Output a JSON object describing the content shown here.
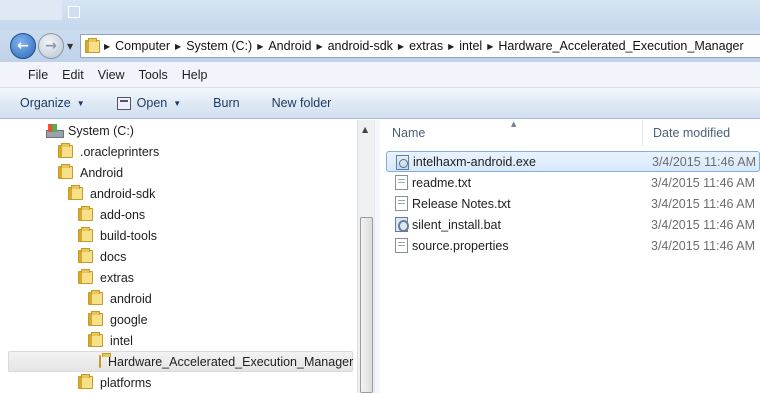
{
  "address": {
    "crumbs": [
      "Computer",
      "System (C:)",
      "Android",
      "android-sdk",
      "extras",
      "intel",
      "Hardware_Accelerated_Execution_Manager"
    ]
  },
  "menu": [
    "File",
    "Edit",
    "View",
    "Tools",
    "Help"
  ],
  "toolbar": {
    "organize": "Organize",
    "open": "Open",
    "burn": "Burn",
    "new_folder": "New folder"
  },
  "tree": [
    {
      "label": "System (C:)",
      "icon": "drive-icon",
      "selected": false
    },
    {
      "label": ".oracleprinters",
      "icon": "folder-icon",
      "selected": false
    },
    {
      "label": "Android",
      "icon": "folder-icon",
      "selected": false
    },
    {
      "label": "android-sdk",
      "icon": "folder-icon",
      "selected": false
    },
    {
      "label": "add-ons",
      "icon": "folder-icon",
      "selected": false
    },
    {
      "label": "build-tools",
      "icon": "folder-icon",
      "selected": false
    },
    {
      "label": "docs",
      "icon": "folder-icon",
      "selected": false
    },
    {
      "label": "extras",
      "icon": "folder-icon",
      "selected": false
    },
    {
      "label": "android",
      "icon": "folder-icon",
      "selected": false
    },
    {
      "label": "google",
      "icon": "folder-icon",
      "selected": false
    },
    {
      "label": "intel",
      "icon": "folder-icon",
      "selected": false
    },
    {
      "label": "Hardware_Accelerated_Execution_Manager",
      "icon": "folder-icon",
      "selected": true
    },
    {
      "label": "platforms",
      "icon": "folder-icon",
      "selected": false
    }
  ],
  "columns": {
    "name": "Name",
    "date": "Date modified"
  },
  "files": [
    {
      "name": "intelhaxm-android.exe",
      "date": "3/4/2015 11:46 AM",
      "icon": "exe-icon",
      "selected": true
    },
    {
      "name": "readme.txt",
      "date": "3/4/2015 11:46 AM",
      "icon": "text-file-icon",
      "selected": false
    },
    {
      "name": "Release Notes.txt",
      "date": "3/4/2015 11:46 AM",
      "icon": "text-file-icon",
      "selected": false
    },
    {
      "name": "silent_install.bat",
      "date": "3/4/2015 11:46 AM",
      "icon": "batch-file-icon",
      "selected": false
    },
    {
      "name": "source.properties",
      "date": "3/4/2015 11:46 AM",
      "icon": "text-file-icon",
      "selected": false
    }
  ]
}
